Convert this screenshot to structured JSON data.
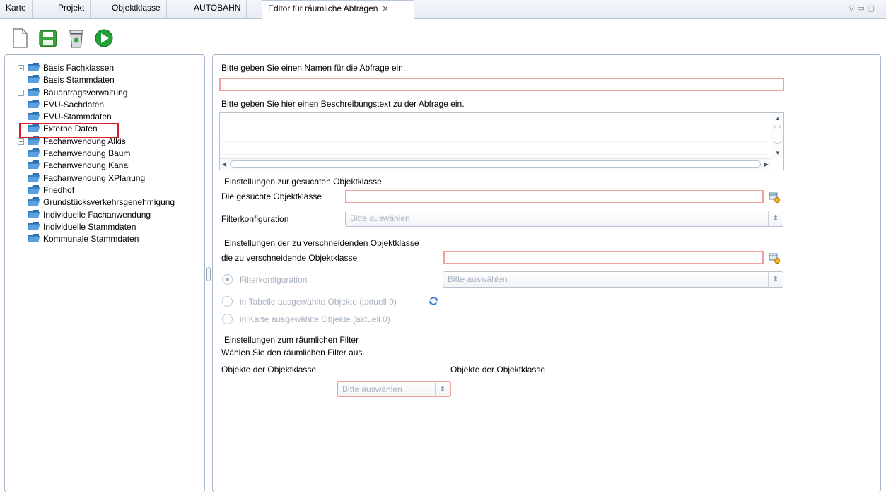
{
  "tabs": [
    {
      "label": "Karte"
    },
    {
      "label": "Projekt"
    },
    {
      "label": "Objektklasse"
    },
    {
      "label": "AUTOBAHN"
    },
    {
      "label": "Editor für räumliche Abfragen",
      "active": true
    }
  ],
  "toolbar": {
    "new_icon": "new-document-icon",
    "save_icon": "save-icon",
    "delete_icon": "trash-icon",
    "run_icon": "run-icon"
  },
  "tree": {
    "items": [
      {
        "label": "Basis Fachklassen",
        "expandable": true
      },
      {
        "label": "Basis Stammdaten",
        "expandable": false
      },
      {
        "label": "Bauantragsverwaltung",
        "expandable": true
      },
      {
        "label": "EVU-Sachdaten",
        "expandable": false
      },
      {
        "label": "EVU-Stammdaten",
        "expandable": false
      },
      {
        "label": "Externe Daten",
        "expandable": false,
        "highlighted": true
      },
      {
        "label": "Fachanwendung Alkis",
        "expandable": true
      },
      {
        "label": "Fachanwendung Baum",
        "expandable": false
      },
      {
        "label": "Fachanwendung Kanal",
        "expandable": false
      },
      {
        "label": "Fachanwendung XPlanung",
        "expandable": false
      },
      {
        "label": "Friedhof",
        "expandable": false
      },
      {
        "label": "Grundstücksverkehrsgenehmigung",
        "expandable": false
      },
      {
        "label": "Individuelle Fachanwendung",
        "expandable": false
      },
      {
        "label": "Individuelle Stammdaten",
        "expandable": false
      },
      {
        "label": "Kommunale Stammdaten",
        "expandable": false
      }
    ]
  },
  "form": {
    "name_prompt": "Bitte geben Sie einen Namen für die Abfrage ein.",
    "name_value": "",
    "desc_prompt": "Bitte geben Sie hier einen Beschreibungstext zu der Abfrage ein.",
    "desc_value": "",
    "searched_section": "Einstellungen zur gesuchten Objektklasse",
    "searched_class_label": "Die gesuchte Objektklasse",
    "searched_class_value": "",
    "filter_label": "Filterkonfiguration",
    "filter_value": "Bitte auswählen",
    "intersect_section": "Einstellungen der zu verschneidenden Objektklasse",
    "intersect_class_label": "die zu verschneidende Objektklasse",
    "intersect_class_value": "",
    "radio_filter_label": "Filterkonfiguration",
    "radio_filter_value": "Bitte auswählen",
    "radio_table_label": "in Tabelle ausgewählte Objekte (aktuell 0)",
    "radio_map_label": "in Karte ausgewählte Objekte (aktuell 0)",
    "spatial_section": "Einstellungen zum räumlichen Filter",
    "spatial_prompt": "Wählen Sie den räumlichen Filter aus.",
    "objects_left": "Objekte der Objektklasse",
    "objects_right": "Objekte der Objektklasse",
    "spatial_select_value": "Bitte auswählen"
  },
  "colors": {
    "required_border": "#f0a29a",
    "highlight_box": "#d91f26",
    "folder": "#3b82c4",
    "run_green": "#22a33a"
  }
}
